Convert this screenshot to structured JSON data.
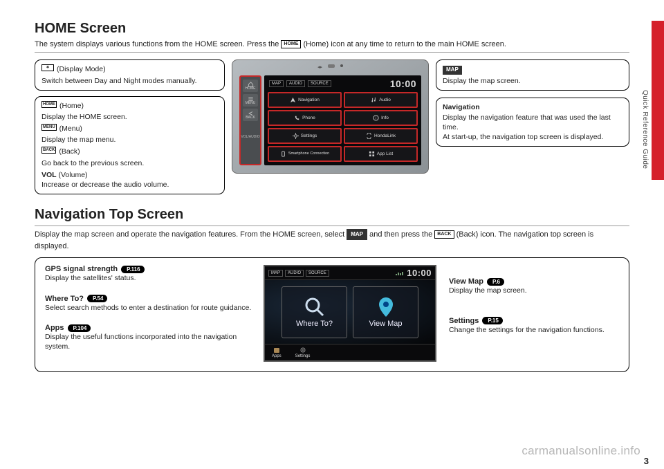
{
  "sideTab": "Quick Reference Guide",
  "section1": {
    "title": "HOME Screen",
    "sub_a": "The system displays various functions from the HOME screen. Press the ",
    "sub_home_icon": "HOME",
    "sub_b": " (Home) icon at any time to return to the main HOME screen.",
    "callout_display_mode": {
      "icon": "✶",
      "label": "(Display Mode)",
      "desc": "Switch between Day and Night modes manually."
    },
    "callout_buttons": {
      "home_icon": "HOME",
      "home_lbl": "(Home)",
      "home_desc": "Display the HOME screen.",
      "menu_icon": "MENU",
      "menu_lbl": "(Menu)",
      "menu_desc": "Display the map menu.",
      "back_icon": "BACK",
      "back_lbl": "(Back)",
      "back_desc": "Go back to the previous screen.",
      "vol_title": "VOL",
      "vol_lbl": "(Volume)",
      "vol_desc": "Increase or decrease the audio volume."
    },
    "callout_map": {
      "chip": "MAP",
      "desc": "Display the map screen."
    },
    "callout_nav": {
      "title": "Navigation",
      "desc": "Display the navigation feature that was used the last time.\nAt start-up, the navigation top screen is displayed."
    },
    "device": {
      "clock": "10:00",
      "top_tabs": [
        "MAP",
        "AUDIO",
        "SOURCE"
      ],
      "sidebar": [
        "HOME",
        "MENU",
        "BACK",
        "VOL/AUDIO"
      ],
      "tiles": [
        {
          "label": "Navigation"
        },
        {
          "label": "Audio"
        },
        {
          "label": "Phone"
        },
        {
          "label": "Info"
        },
        {
          "label": "Settings"
        },
        {
          "label": "HondaLink"
        },
        {
          "label": "Smartphone Connection"
        },
        {
          "label": "App List"
        }
      ]
    }
  },
  "section2": {
    "title": "Navigation Top Screen",
    "sub_a": "Display the map screen and operate the navigation features. From the HOME screen, select ",
    "map_chip": "MAP",
    "sub_b": " and then press the ",
    "back_icon": "BACK",
    "sub_c": " (Back) icon. The navigation top screen is displayed.",
    "gps": {
      "title": "GPS signal strength",
      "pill": "P.116",
      "desc": "Display the satellites' status."
    },
    "where": {
      "title": "Where To?",
      "pill": "P.54",
      "desc": "Select search methods to enter a destination for route guidance."
    },
    "apps": {
      "title": "Apps",
      "pill": "P.104",
      "desc": "Display the useful functions incorporated into the navigation system."
    },
    "viewmap": {
      "title": "View Map",
      "pill": "P.6",
      "desc": "Display the map screen."
    },
    "settings": {
      "title": "Settings",
      "pill": "P.15",
      "desc": "Change the settings for the navigation functions."
    },
    "navscr": {
      "clock": "10:00",
      "tabs": [
        "MAP",
        "AUDIO",
        "SOURCE"
      ],
      "tile1": "Where To?",
      "tile2": "View Map",
      "btm1": "Apps",
      "btm2": "Settings"
    }
  },
  "watermark": "carmanualsonline.info",
  "pageNumber": "3"
}
